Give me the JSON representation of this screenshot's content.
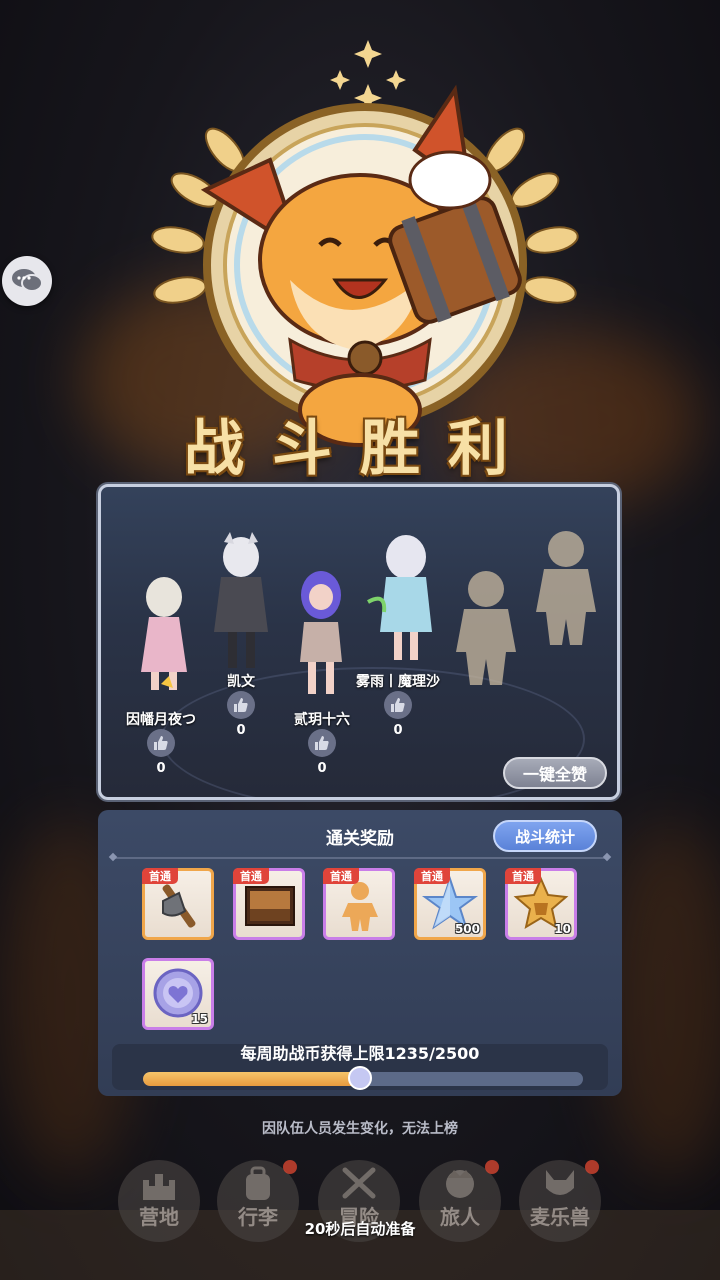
{
  "header": {
    "victory_title": "战斗胜利"
  },
  "team": {
    "members": [
      {
        "name": "因幡月夜つ",
        "likes": "0"
      },
      {
        "name": "凯文",
        "likes": "0"
      },
      {
        "name": "贰玥十六",
        "likes": "0"
      },
      {
        "name": "雾雨丨魔理沙",
        "likes": "0"
      }
    ],
    "like_all_label": "一键全赞"
  },
  "rewards": {
    "title": "通关奖励",
    "stats_button": "战斗统计",
    "items": [
      {
        "tag": "首通",
        "icon": "axe-icon",
        "quantity": "",
        "rarity": "orange"
      },
      {
        "tag": "首通",
        "icon": "painting-icon",
        "quantity": "",
        "rarity": "purple"
      },
      {
        "tag": "首通",
        "icon": "silhouette-icon",
        "quantity": "",
        "rarity": "purple"
      },
      {
        "tag": "首通",
        "icon": "crystal-star-icon",
        "quantity": "500",
        "rarity": "orange"
      },
      {
        "tag": "首通",
        "icon": "star-cookie-icon",
        "quantity": "10",
        "rarity": "purple"
      },
      {
        "tag": "",
        "icon": "heart-coin-icon",
        "quantity": "15",
        "rarity": "purple"
      }
    ],
    "weekly_limit_text": "每周助战币获得上限1235/2500",
    "weekly_progress": 0.494
  },
  "notice": "因队伍人员发生变化，无法上榜",
  "bottom_nav": [
    {
      "label": "营地",
      "icon": "castle-icon",
      "dot": false
    },
    {
      "label": "行李",
      "icon": "backpack-icon",
      "dot": true
    },
    {
      "label": "冒险",
      "icon": "crossed-swords-icon",
      "dot": false
    },
    {
      "label": "旅人",
      "icon": "traveler-icon",
      "dot": true
    },
    {
      "label": "麦乐兽",
      "icon": "pet-icon",
      "dot": true
    }
  ],
  "auto_ready_text": "20秒后自动准备",
  "colors": {
    "gold": "#f7e0a6",
    "panel": "#3c4a66",
    "progress_fill": "#e89a3e",
    "badge_red": "#e0443a"
  }
}
